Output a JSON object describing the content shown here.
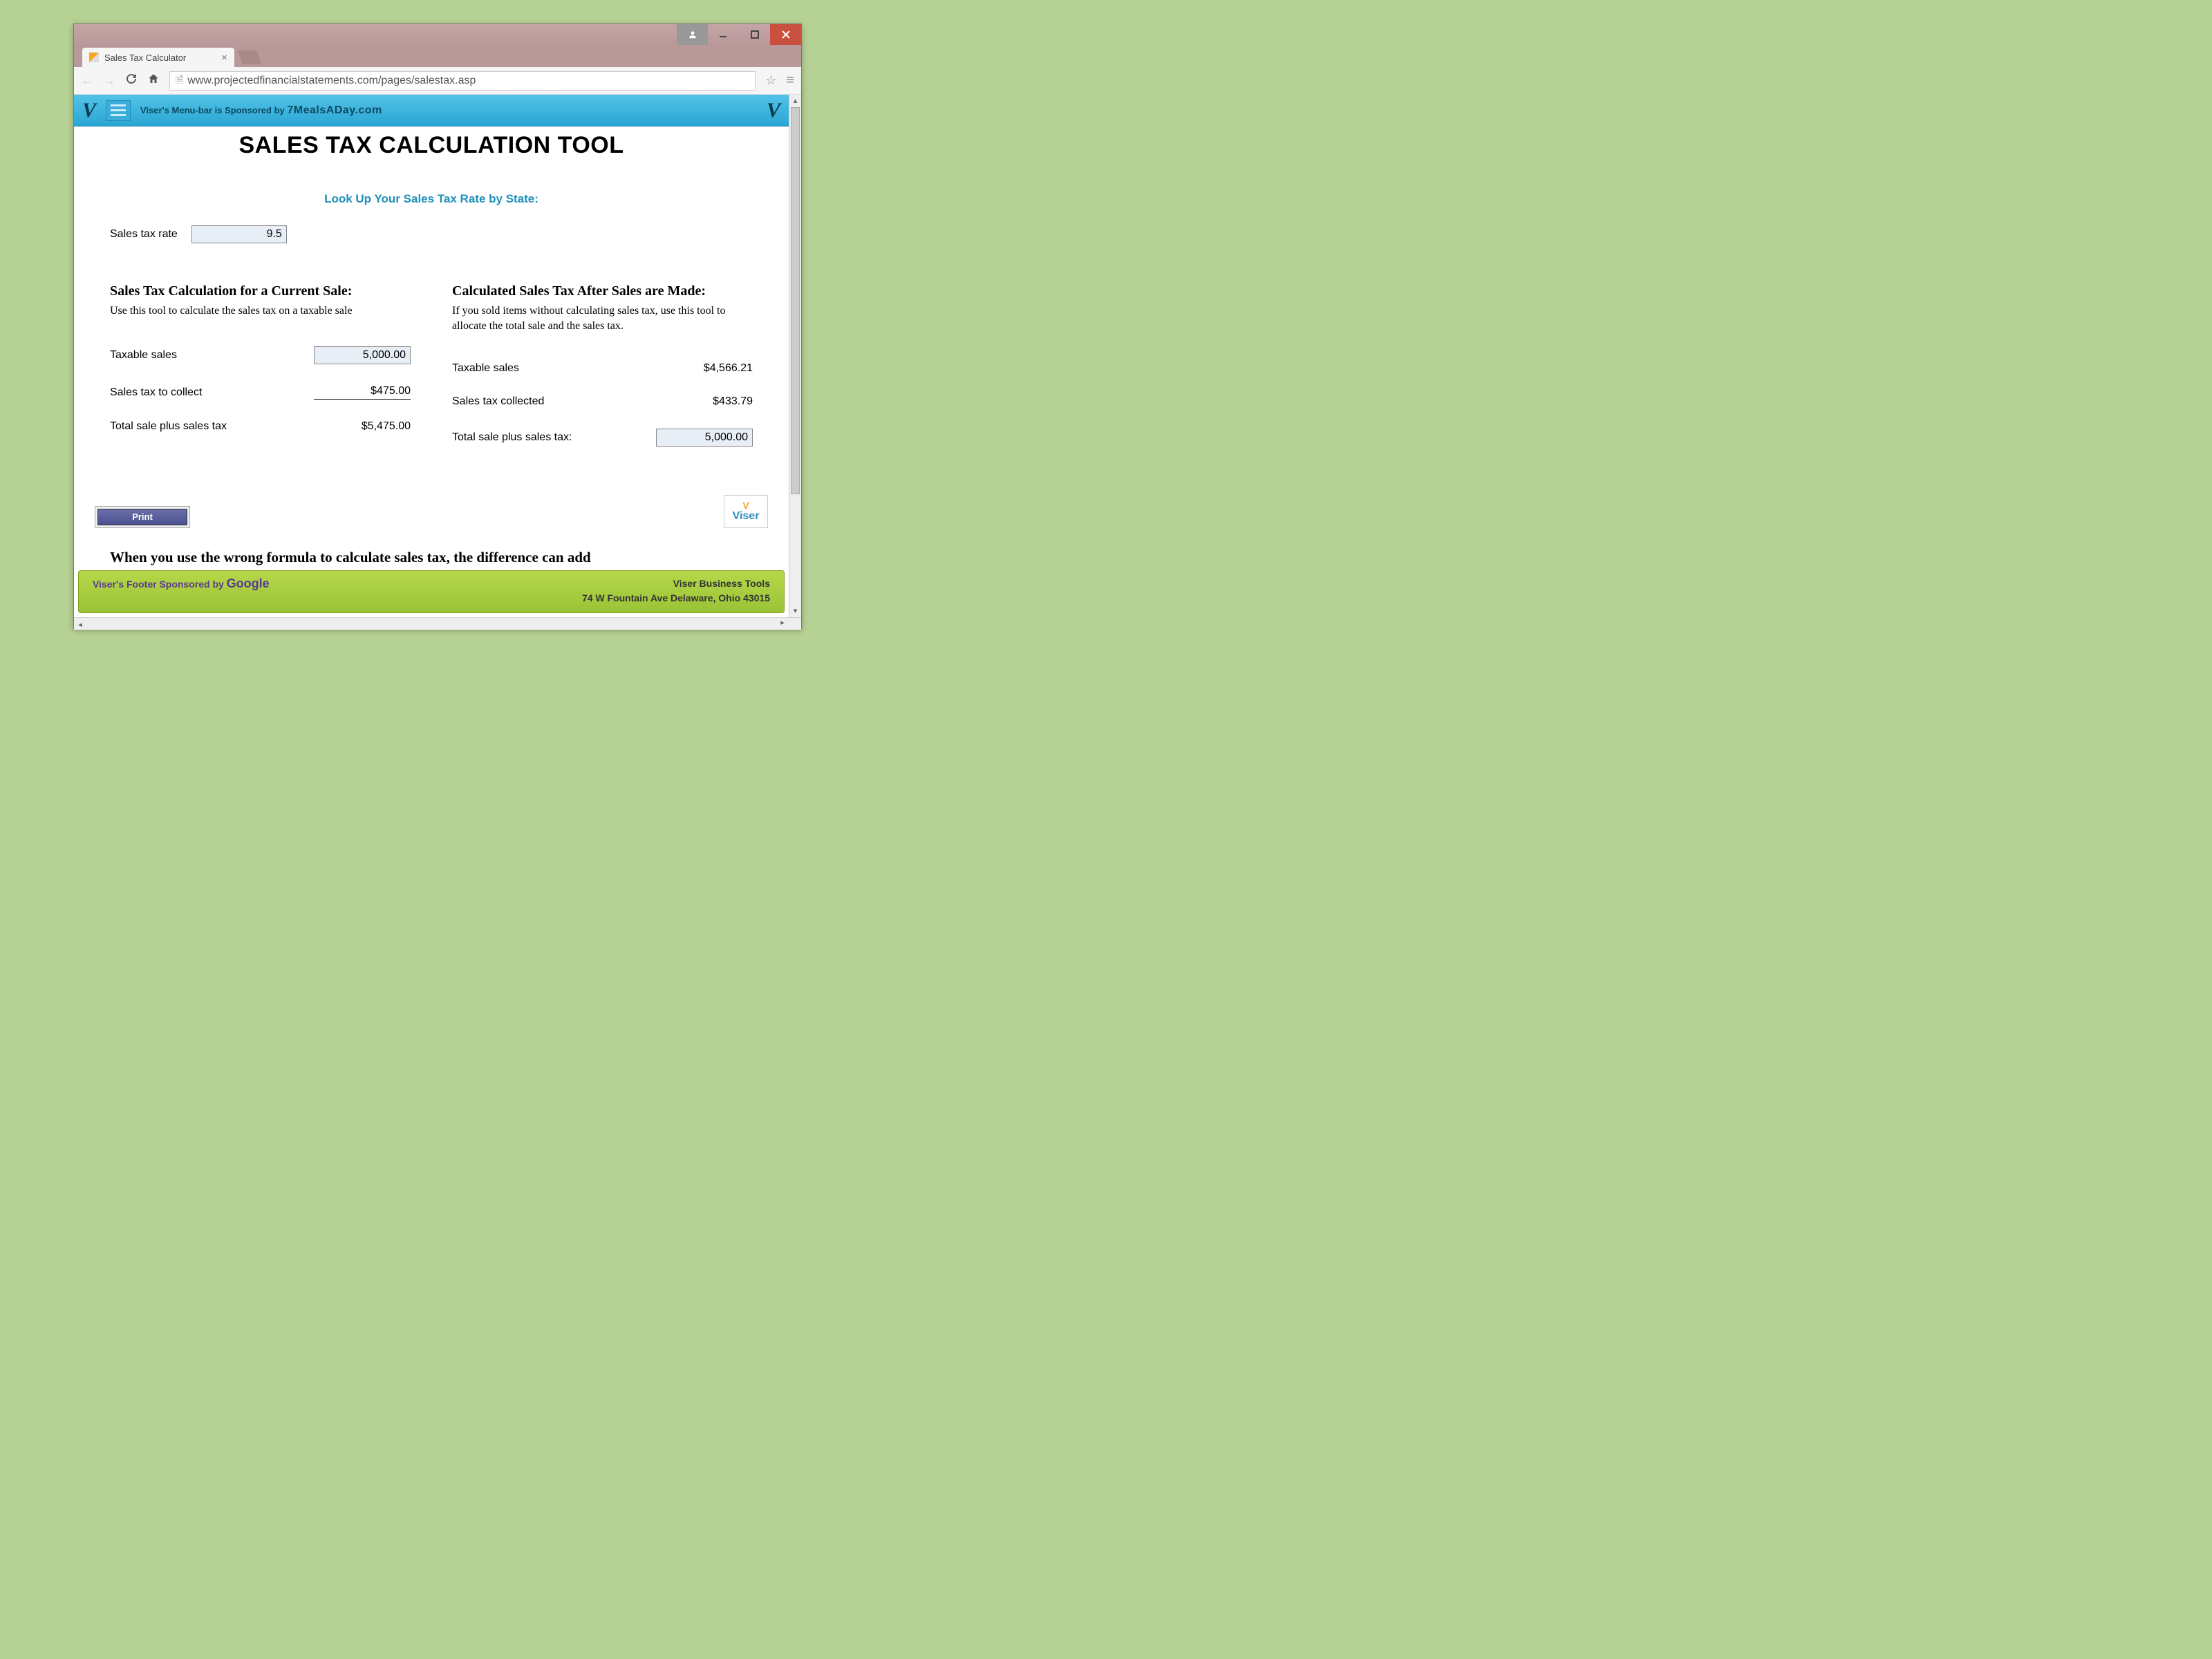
{
  "browser": {
    "tab_title": "Sales Tax Calculator",
    "url": "www.projectedfinancialstatements.com/pages/salestax.asp"
  },
  "bluebar": {
    "sponsor_prefix": "Viser's Menu-bar is Sponsored by ",
    "sponsor_brand": "7MealsADay.com"
  },
  "page": {
    "title": "SALES TAX CALCULATION TOOL",
    "lookup_link": "Look Up Your Sales Tax Rate by State:",
    "rate_label": "Sales tax rate",
    "rate_value": "9.5"
  },
  "left": {
    "title": "Sales Tax Calculation for a Current Sale:",
    "desc": "Use this tool to calculate the sales tax on a taxable sale",
    "row1_label": "Taxable sales",
    "row1_value": "5,000.00",
    "row2_label": "Sales tax to collect",
    "row2_value": "$475.00",
    "row3_label": "Total sale plus sales tax",
    "row3_value": "$5,475.00"
  },
  "right": {
    "title": "Calculated Sales Tax After Sales are Made:",
    "desc": "If you sold items without calculating sales tax, use this tool to allocate the total sale and the sales tax.",
    "row1_label": "Taxable sales",
    "row1_value": "$4,566.21",
    "row2_label": "Sales tax collected",
    "row2_value": "$433.79",
    "row3_label": "Total sale plus sales tax:",
    "row3_value": "5,000.00"
  },
  "print_label": "Print",
  "viser_badge": "Viser",
  "cutoff": "When you use the wrong formula to calculate sales tax, the difference can add",
  "footer": {
    "left_prefix": "Viser's Footer Sponsored by ",
    "left_brand": "Google",
    "right_line1": "Viser Business Tools",
    "right_line2": "74 W Fountain Ave Delaware, Ohio 43015"
  }
}
